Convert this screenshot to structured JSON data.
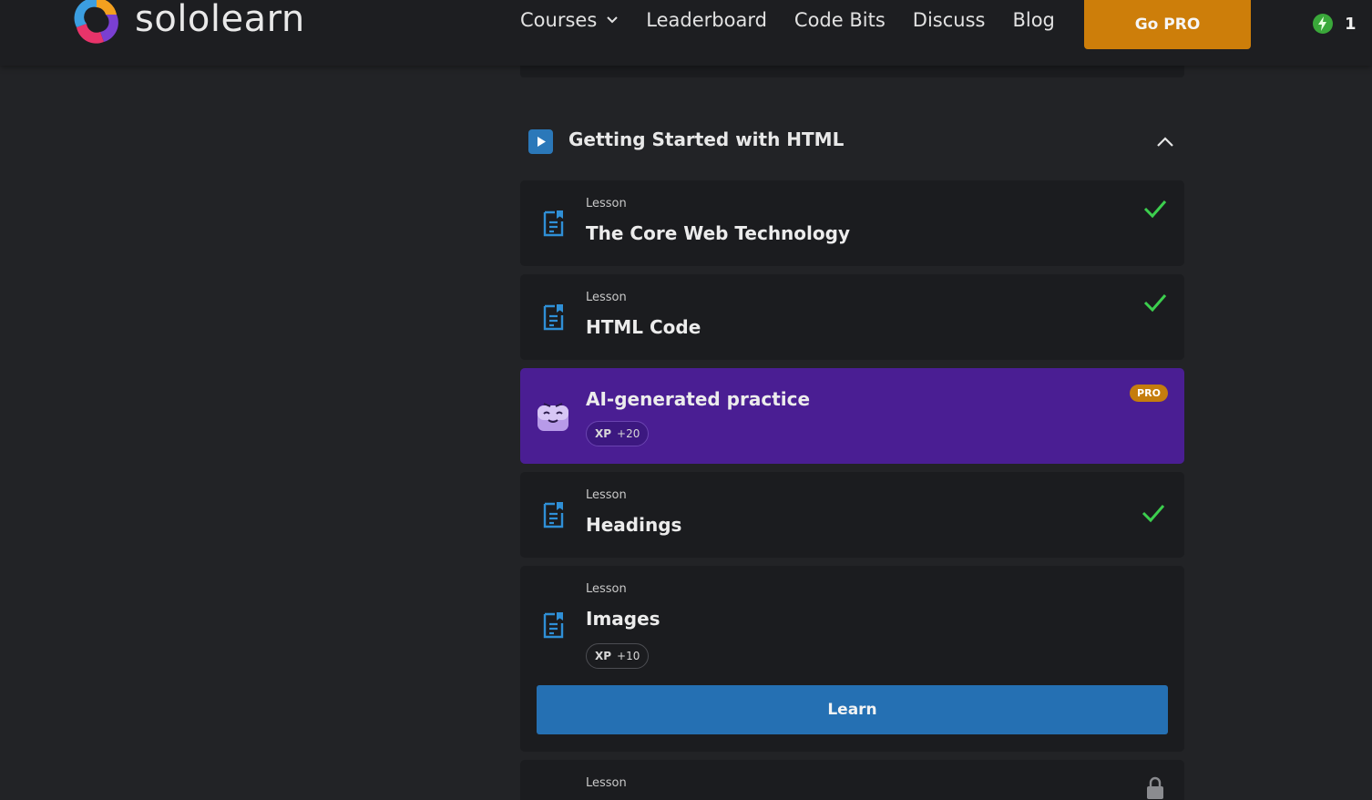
{
  "header": {
    "logo_text": "sololearn",
    "nav": [
      "Courses",
      "Leaderboard",
      "Code Bits",
      "Discuss",
      "Blog"
    ],
    "go_pro_label": "Go PRO",
    "streak_count": "1"
  },
  "section": {
    "title": "Getting Started with HTML"
  },
  "items": [
    {
      "kicker": "Lesson",
      "title": "The Core Web Technology",
      "status": "completed"
    },
    {
      "kicker": "Lesson",
      "title": "HTML Code",
      "status": "completed"
    },
    {
      "title": "AI-generated practice",
      "badge": "PRO",
      "xp_label": "XP",
      "xp_value": "+20"
    },
    {
      "kicker": "Lesson",
      "title": "Headings",
      "status": "completed"
    },
    {
      "kicker": "Lesson",
      "title": "Images",
      "xp_label": "XP",
      "xp_value": "+10",
      "action": "Learn",
      "status": "current"
    },
    {
      "kicker": "Lesson",
      "status": "locked"
    }
  ],
  "colors": {
    "background": "#222326",
    "card": "#1b1c1f",
    "accent_blue": "#2570b3",
    "pro_orange": "#cd7e0a",
    "practice_purple": "#4a1e93",
    "check_green": "#3ccf4e"
  }
}
